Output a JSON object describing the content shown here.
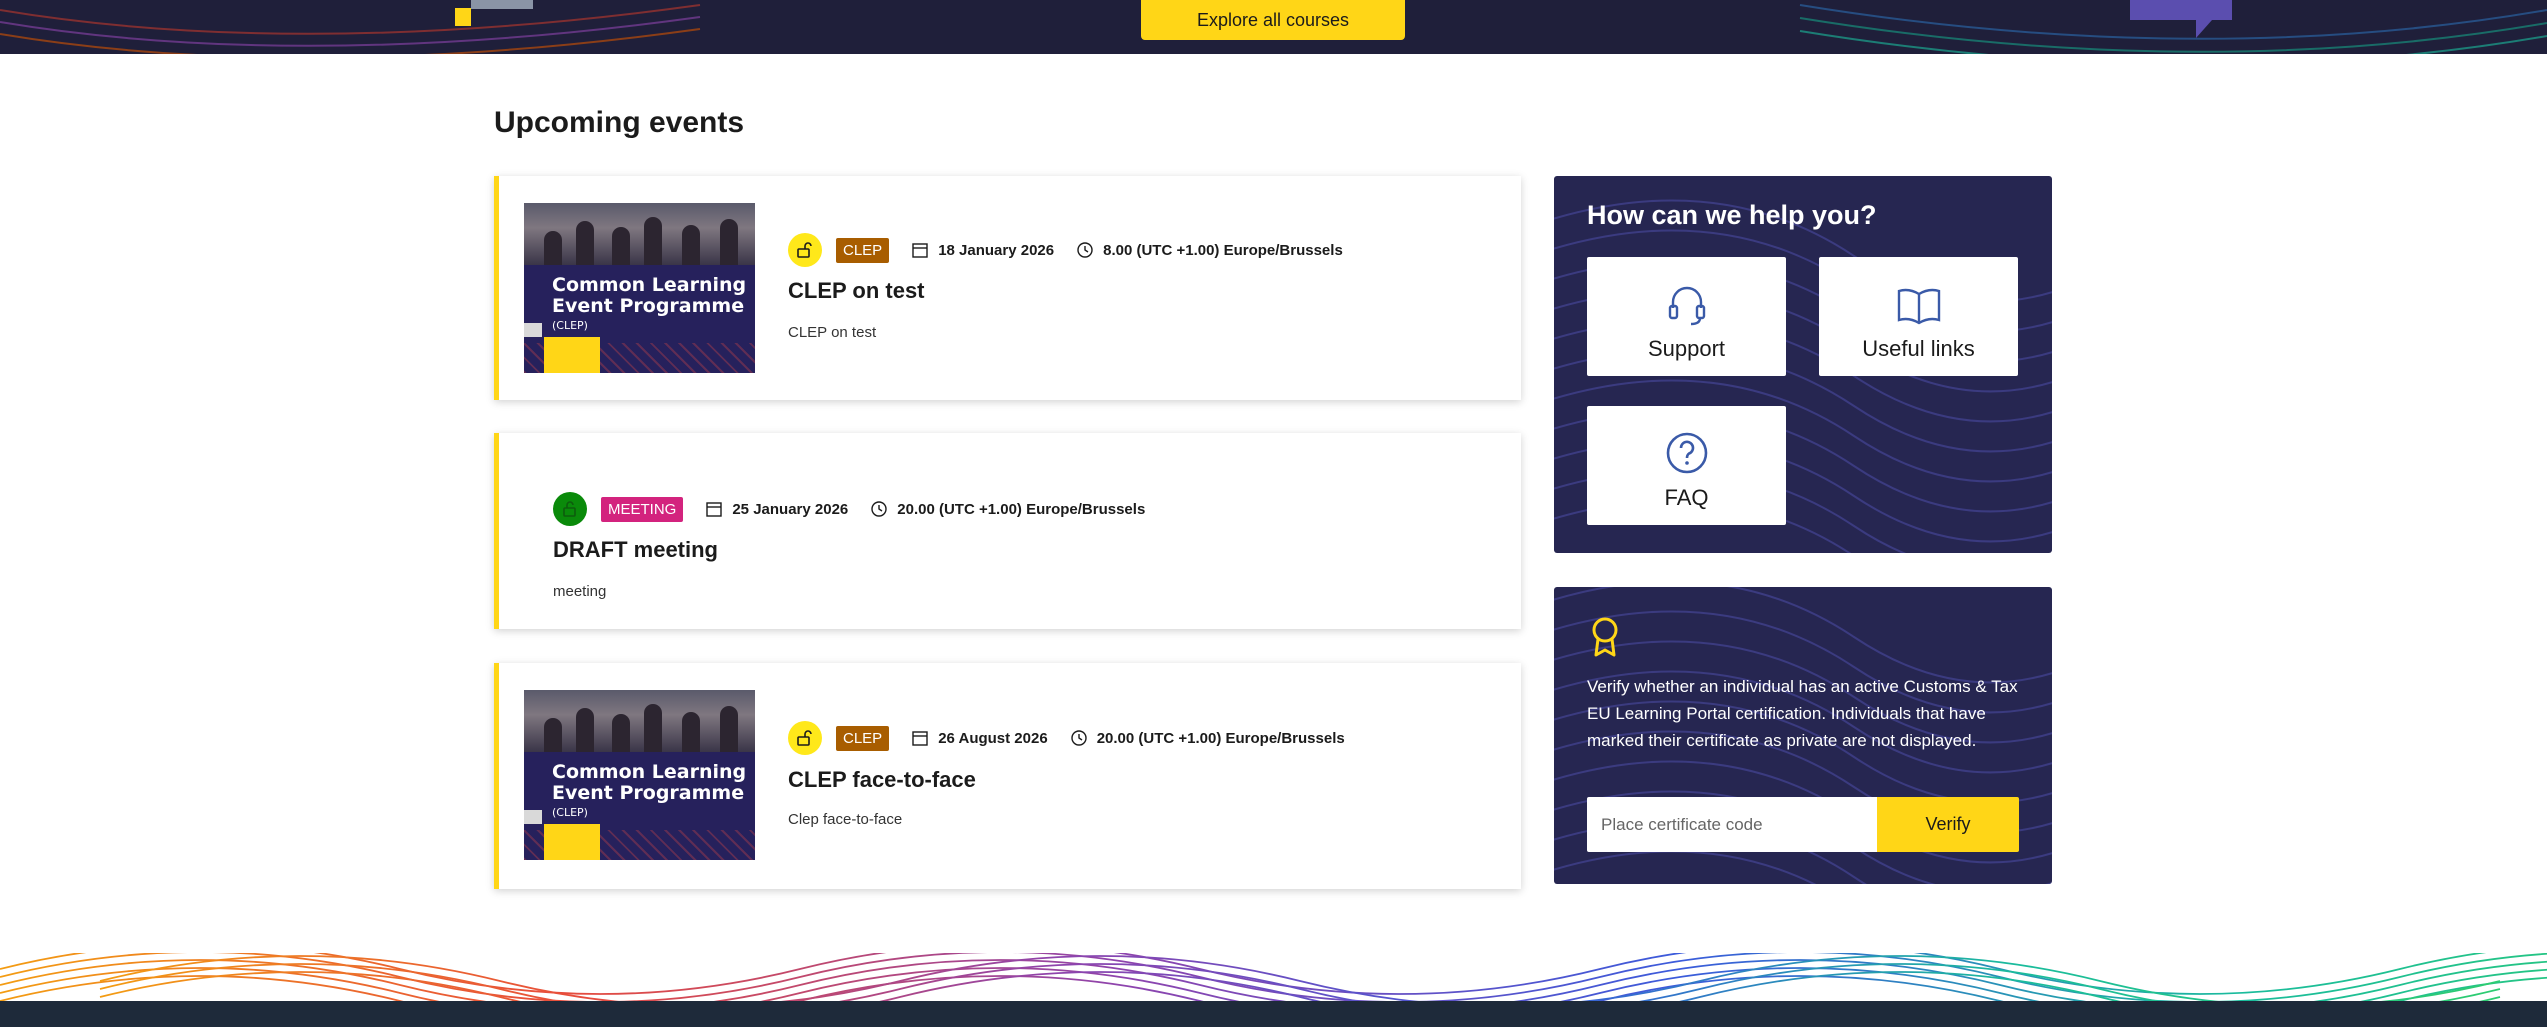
{
  "header": {
    "explore_label": "Explore all courses"
  },
  "section_title": "Upcoming events",
  "events": [
    {
      "thumb_title_line1": "Common Learning",
      "thumb_title_line2": "Event Programme",
      "thumb_subtitle": "(CLEP)",
      "status_icon": "unlock-icon",
      "badge": "CLEP",
      "badge_color": "#a85d00",
      "status_color": "#ffe81a",
      "date": "18 January 2026",
      "time": "8.00 (UTC +1.00) Europe/Brussels",
      "title": "CLEP on test",
      "description": "CLEP on test"
    },
    {
      "status_icon": "unlock-icon",
      "badge": "MEETING",
      "badge_color": "#d3237e",
      "status_color": "#0a8a0a",
      "date": "25 January 2026",
      "time": "20.00 (UTC +1.00) Europe/Brussels",
      "title": "DRAFT meeting",
      "description": "meeting"
    },
    {
      "thumb_title_line1": "Common Learning",
      "thumb_title_line2": "Event Programme",
      "thumb_subtitle": "(CLEP)",
      "status_icon": "unlock-icon",
      "badge": "CLEP",
      "badge_color": "#a85d00",
      "status_color": "#ffe81a",
      "date": "26 August 2026",
      "time": "20.00 (UTC +1.00) Europe/Brussels",
      "title": "CLEP face-to-face",
      "description": "Clep face-to-face"
    }
  ],
  "help": {
    "title": "How can we help you?",
    "tiles": [
      {
        "label": "Support",
        "icon": "headset-icon"
      },
      {
        "label": "Useful links",
        "icon": "book-icon"
      },
      {
        "label": "FAQ",
        "icon": "question-circle-icon"
      }
    ]
  },
  "verify": {
    "icon": "award-icon",
    "text": "Verify whether an individual has an active Customs & Tax EU Learning Portal certification. Individuals that have marked their certificate as private are not displayed.",
    "placeholder": "Place certificate code",
    "button_label": "Verify"
  },
  "colors": {
    "accent": "#ffd617",
    "panel": "#262651",
    "icon_blue": "#3a5aa8"
  }
}
